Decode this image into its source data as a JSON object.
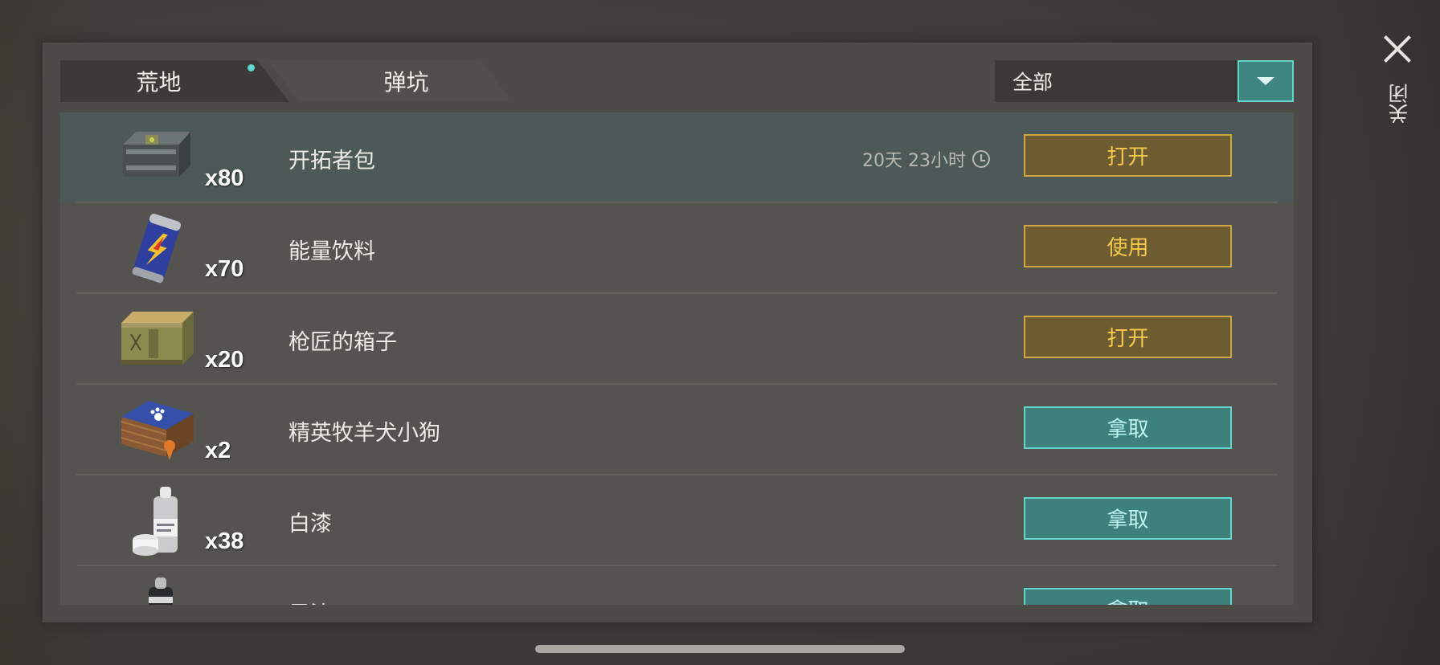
{
  "tabs": [
    {
      "label": "荒地",
      "active": true,
      "has_dot": true
    },
    {
      "label": "弹坑",
      "active": false,
      "has_dot": false
    }
  ],
  "filter": {
    "selected": "全部",
    "icon": "dropdown-triangle-icon"
  },
  "close": {
    "label": "关闭",
    "icon": "close-x-icon"
  },
  "colors": {
    "accent_teal": "#3d807c",
    "accent_gold": "#6d5b32",
    "gold_text": "#f6c94c",
    "teal_dot": "#5fd6d0"
  },
  "items": [
    {
      "name": "开拓者包",
      "qty": "x80",
      "timer": "20天 23小时",
      "action": "打开",
      "action_style": "gold",
      "icon": "metal-crate-icon",
      "highlight": true
    },
    {
      "name": "能量饮料",
      "qty": "x70",
      "timer": "",
      "action": "使用",
      "action_style": "gold",
      "icon": "energy-drink-can-icon",
      "highlight": false
    },
    {
      "name": "枪匠的箱子",
      "qty": "x20",
      "timer": "",
      "action": "打开",
      "action_style": "gold",
      "icon": "wooden-crate-icon",
      "highlight": false
    },
    {
      "name": "精英牧羊犬小狗",
      "qty": "x2",
      "timer": "",
      "action": "拿取",
      "action_style": "teal",
      "icon": "dog-box-icon",
      "highlight": false
    },
    {
      "name": "白漆",
      "qty": "x38",
      "timer": "",
      "action": "拿取",
      "action_style": "teal",
      "icon": "white-paint-can-icon",
      "highlight": false
    },
    {
      "name": "黑漆",
      "qty": "",
      "timer": "",
      "action": "拿取",
      "action_style": "teal",
      "icon": "black-paint-can-icon",
      "highlight": false
    }
  ]
}
